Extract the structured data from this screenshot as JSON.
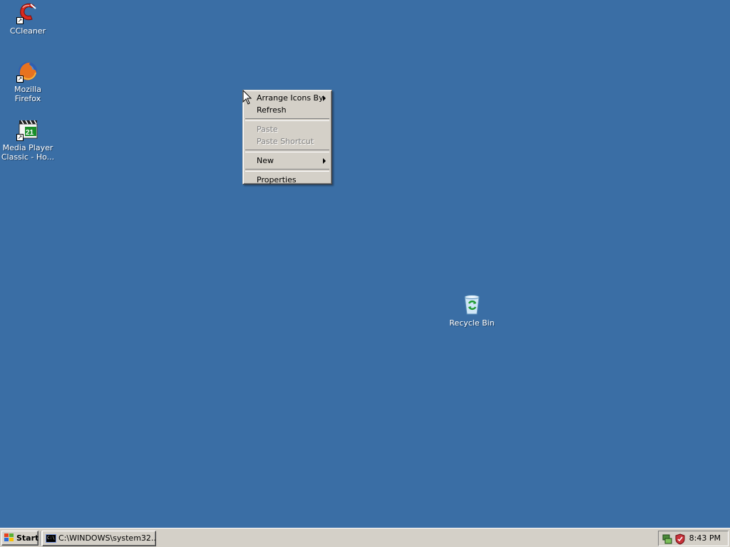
{
  "desktop": {
    "background_color": "#3a6ea5",
    "icons": [
      {
        "label": "CCleaner",
        "icon": "ccleaner-icon",
        "shortcut": true
      },
      {
        "label": "Mozilla Firefox",
        "icon": "firefox-icon",
        "shortcut": true
      },
      {
        "label": "Media Player Classic - Ho...",
        "icon": "media-player-classic-icon",
        "shortcut": true
      },
      {
        "label": "Recycle Bin",
        "icon": "recycle-bin-icon",
        "shortcut": false
      }
    ]
  },
  "context_menu": {
    "items": [
      {
        "label": "Arrange Icons By",
        "submenu": true,
        "disabled": false
      },
      {
        "label": "Refresh",
        "submenu": false,
        "disabled": false
      },
      {
        "label": "Paste",
        "submenu": false,
        "disabled": true
      },
      {
        "label": "Paste Shortcut",
        "submenu": false,
        "disabled": true
      },
      {
        "label": "New",
        "submenu": true,
        "disabled": false
      },
      {
        "label": "Properties",
        "submenu": false,
        "disabled": false
      }
    ]
  },
  "taskbar": {
    "start_label": "Start",
    "tasks": [
      {
        "label": "C:\\WINDOWS\\system32...",
        "icon": "command-prompt-icon"
      }
    ],
    "tray": {
      "icons": [
        "network-tray-icon",
        "security-shield-tray-icon"
      ],
      "clock": "8:43 PM"
    }
  }
}
